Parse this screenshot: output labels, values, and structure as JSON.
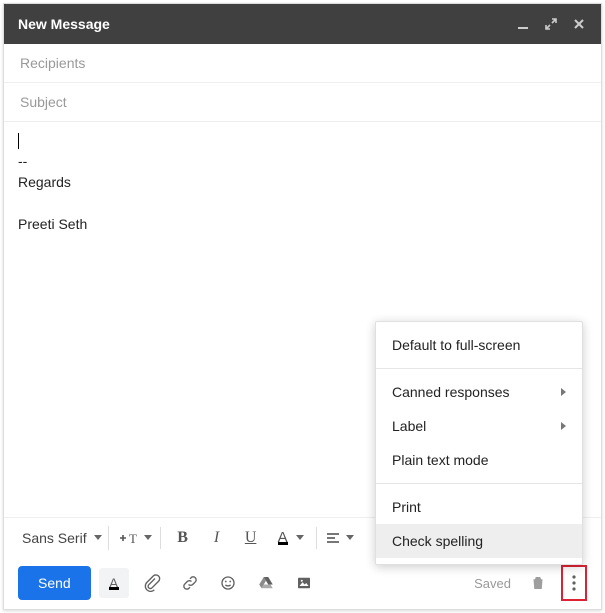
{
  "header": {
    "title": "New Message"
  },
  "fields": {
    "recipients_placeholder": "Recipients",
    "subject_placeholder": "Subject"
  },
  "body": {
    "sig_divider": "--",
    "sig_line1": "Regards",
    "sig_line2": "Preeti Seth"
  },
  "format": {
    "font_name": "Sans Serif"
  },
  "bottom": {
    "send_label": "Send",
    "saved_label": "Saved"
  },
  "menu": {
    "default_fullscreen": "Default to full-screen",
    "canned": "Canned responses",
    "label": "Label",
    "plain": "Plain text mode",
    "print": "Print",
    "check_spelling": "Check spelling"
  }
}
